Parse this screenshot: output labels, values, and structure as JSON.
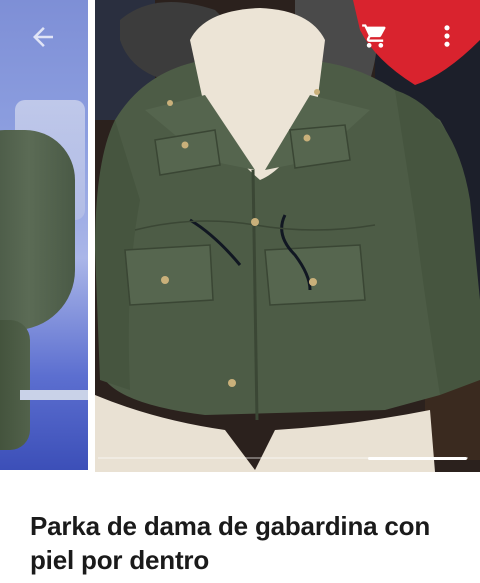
{
  "product": {
    "title": "Parka de dama de gabardina con piel por dentro"
  },
  "toolbar": {
    "back_icon": "arrow-back-icon",
    "cart_icon": "shopping-cart-icon",
    "menu_icon": "more-vert-icon"
  },
  "gallery": {
    "images": [
      "green parka (side view)",
      "green parka with fleece lining"
    ],
    "current_index": 1
  },
  "colors": {
    "accent": "#d9232e",
    "parka": "#4a5a44",
    "lining": "#ece4d6",
    "icon": "#ffffff"
  }
}
